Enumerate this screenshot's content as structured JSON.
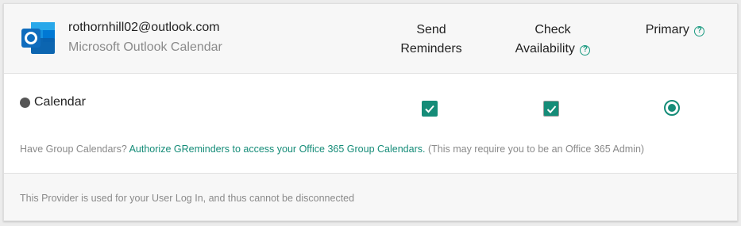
{
  "account": {
    "email": "rothornhill02@outlook.com",
    "provider_name": "Microsoft Outlook Calendar",
    "logo_icon": "outlook-logo-icon"
  },
  "columns": {
    "send_reminders_line1": "Send",
    "send_reminders_line2": "Reminders",
    "check_availability_line1": "Check",
    "check_availability_line2": "Availability",
    "primary": "Primary",
    "help_icon": "?"
  },
  "calendar_row": {
    "label": "Calendar",
    "dot_color": "#555555",
    "send_reminders_checked": true,
    "check_availability_checked": true,
    "primary_selected": true
  },
  "group_calendars": {
    "prefix": "Have Group Calendars?",
    "link_text": "Authorize GReminders to access your Office 365 Group Calendars.",
    "suffix": "(This may require you to be an Office 365 Admin)"
  },
  "footer": {
    "text": "This Provider is used for your User Log In, and thus cannot be disconnected"
  },
  "colors": {
    "accent": "#158c78",
    "header_bg": "#f7f7f7"
  }
}
